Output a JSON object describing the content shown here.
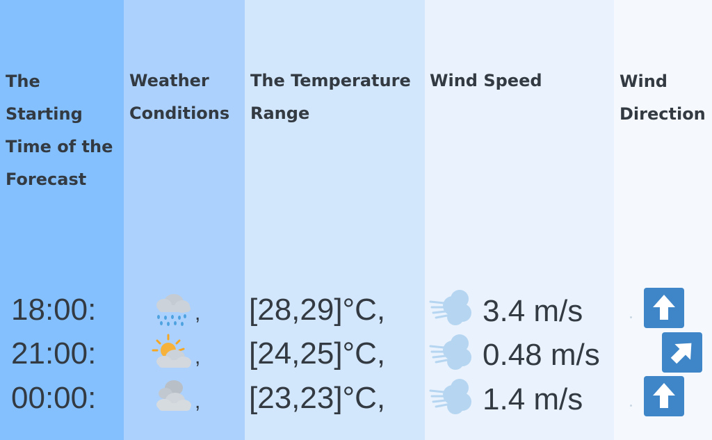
{
  "headers": {
    "start_time": "The Starting Time of the Forecast",
    "conditions": "Weather Conditions",
    "temperature": "The Temperature Range",
    "wind_speed": "Wind Speed",
    "wind_direction": "Wind Direction"
  },
  "rows": [
    {
      "time": "18:00:",
      "condition_icon": "rain-cloud-icon",
      "comma": ",",
      "temperature": "[28,29]°C,",
      "wind_icon": "wind-icon",
      "wind_speed": "3.4 m/s",
      "direction_icon": "arrow-up-icon"
    },
    {
      "time": "21:00:",
      "condition_icon": "partly-sunny-icon",
      "comma": ",",
      "temperature": "[24,25]°C,",
      "wind_icon": "wind-icon",
      "wind_speed": "0.48 m/s",
      "direction_icon": "arrow-up-right-icon"
    },
    {
      "time": "00:00:",
      "condition_icon": "cloudy-icon",
      "comma": ",",
      "temperature": "[23,23]°C,",
      "wind_icon": "wind-icon",
      "wind_speed": "1.4 m/s",
      "direction_icon": "arrow-up-icon"
    }
  ],
  "colors": {
    "column_1": "#84c0fe",
    "column_2": "#acd1fc",
    "column_3": "#d2e6fc",
    "column_4": "#e9f2fd",
    "column_5": "#f5f9fe",
    "arrow_button": "#3e86c7",
    "text": "#333a41"
  }
}
